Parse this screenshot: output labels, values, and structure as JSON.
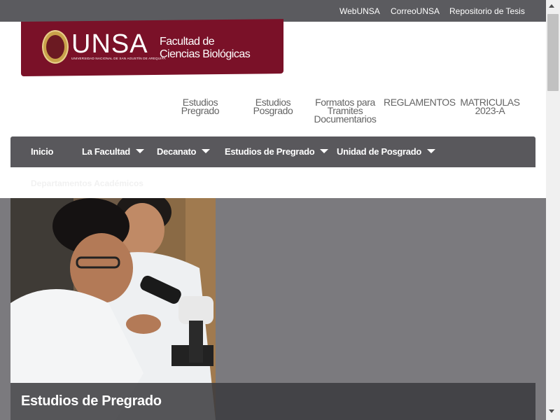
{
  "topbar": {
    "links": [
      "WebUNSA",
      "CorreoUNSA",
      "Repositorio de Tesis"
    ]
  },
  "logo": {
    "wordmark": "UNSA",
    "subtitle": "UNIVERSIDAD NACIONAL DE SAN AGUSTÍN DE AREQUIPA",
    "faculty_line1": "Facultad de",
    "faculty_line2": "Ciencias Biológicas"
  },
  "sublinks": [
    {
      "line1": "Estudios",
      "line2": "Pregrado",
      "line3": ""
    },
    {
      "line1": "Estudios",
      "line2": "Posgrado",
      "line3": ""
    },
    {
      "line1": "Formatos para",
      "line2": "Tramites",
      "line3": "Documentarios"
    },
    {
      "line1": "REGLAMENTOS",
      "line2": "",
      "line3": ""
    },
    {
      "line1": "MATRICULAS",
      "line2": "2023-A",
      "line3": ""
    }
  ],
  "mainnav": {
    "items": [
      "Inicio",
      "La Facultad",
      "Decanato",
      "Estudios de Pregrado",
      "Unidad de Posgrado"
    ],
    "overflow_item": "Departamentos Académicos"
  },
  "hero": {
    "caption": "Estudios de Pregrado"
  },
  "colors": {
    "brand": "#7a1128",
    "topbar": "#5b5b5f",
    "nav": "#59585c"
  }
}
